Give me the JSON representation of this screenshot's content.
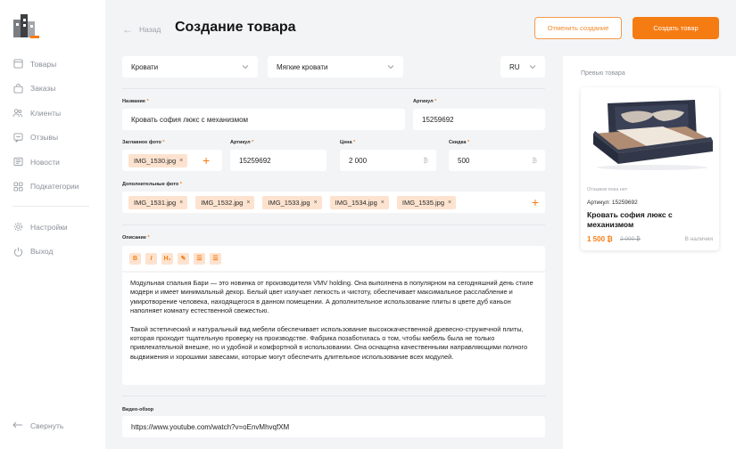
{
  "nav": {
    "items": [
      {
        "label": "Товары",
        "icon": "products-icon"
      },
      {
        "label": "Заказы",
        "icon": "bag-icon"
      },
      {
        "label": "Клиенты",
        "icon": "users-icon"
      },
      {
        "label": "Отзывы",
        "icon": "reviews-icon"
      },
      {
        "label": "Новости",
        "icon": "news-icon"
      },
      {
        "label": "Подкатегории",
        "icon": "grid-icon"
      }
    ],
    "settings": "Настройки",
    "logout": "Выход",
    "collapse": "Свернуть"
  },
  "header": {
    "back": "Назад",
    "title": "Создание товара",
    "cancel": "Отменить создание",
    "create": "Создать товар"
  },
  "form": {
    "category": "Кровати",
    "subcategory": "Мягкие кровати",
    "language": "RU",
    "name_label": "Название",
    "name_value": "Кровать софия люкс с механизмом",
    "sku_label": "Артикул",
    "sku_value": "15259692",
    "main_photo_label": "Заглавное фото",
    "main_photo": "IMG_1530.jpg",
    "sku2_label": "Артикул",
    "sku2_value": "15259692",
    "price_label": "Цена",
    "price_value": "2 000",
    "discount_label": "Скидка",
    "discount_value": "500",
    "currency": "₿",
    "extra_photos_label": "Дополнительные фото",
    "extra_photos": [
      "IMG_1531.jpg",
      "IMG_1532.jpg",
      "IMG_1533.jpg",
      "IMG_1534.jpg",
      "IMG_1535.jpg"
    ],
    "description_label": "Описание",
    "toolbar": {
      "bold": "B",
      "italic": "I",
      "heading": "H₁",
      "highlight": "✎",
      "bullets": "☰",
      "numbers": "☰"
    },
    "description_p1": "Модульная спальня Бари — это новинка от производителя VMV holding. Она выполнена в популярном на сегодняшний день стиле модерн и имеет минимальный декор. Белый цвет излучает легкость и чистоту, обеспечивает максимальное расслабление и умиротворение человека, находящегося в данном помещении. А дополнительное использование плиты в цвете дуб каньон наполняет комнату естественной свежестью.",
    "description_p2": "Такой эстетический и натуральный вид мебели обеспечивает использование высококачественной древесно-стружечной плиты, которая проходит тщательную проверку на производстве. Фабрика позаботилась о том, чтобы мебель была не только привлекательной внешне, но и удобной и комфортной в использовании. Она оснащена качественными направляющими полного выдвижения и хорошими завесами, которые могут обеспечить длительное использование всех модулей.",
    "video_label": "Видео-обзор",
    "video_value": "https://www.youtube.com/watch?v=oEnvMhvqfXM"
  },
  "preview": {
    "title": "Превью товара",
    "reviews": "Отзывов пока нет",
    "sku": "Артикул: 15259692",
    "name": "Кровать софия люкс с механизмом",
    "price": "1 500 ₿",
    "old_price": "2 000 ₿",
    "stock": "В наличии"
  },
  "colors": {
    "accent": "#f57c13",
    "chip": "#fde3cf",
    "background": "#f3f4f6"
  }
}
